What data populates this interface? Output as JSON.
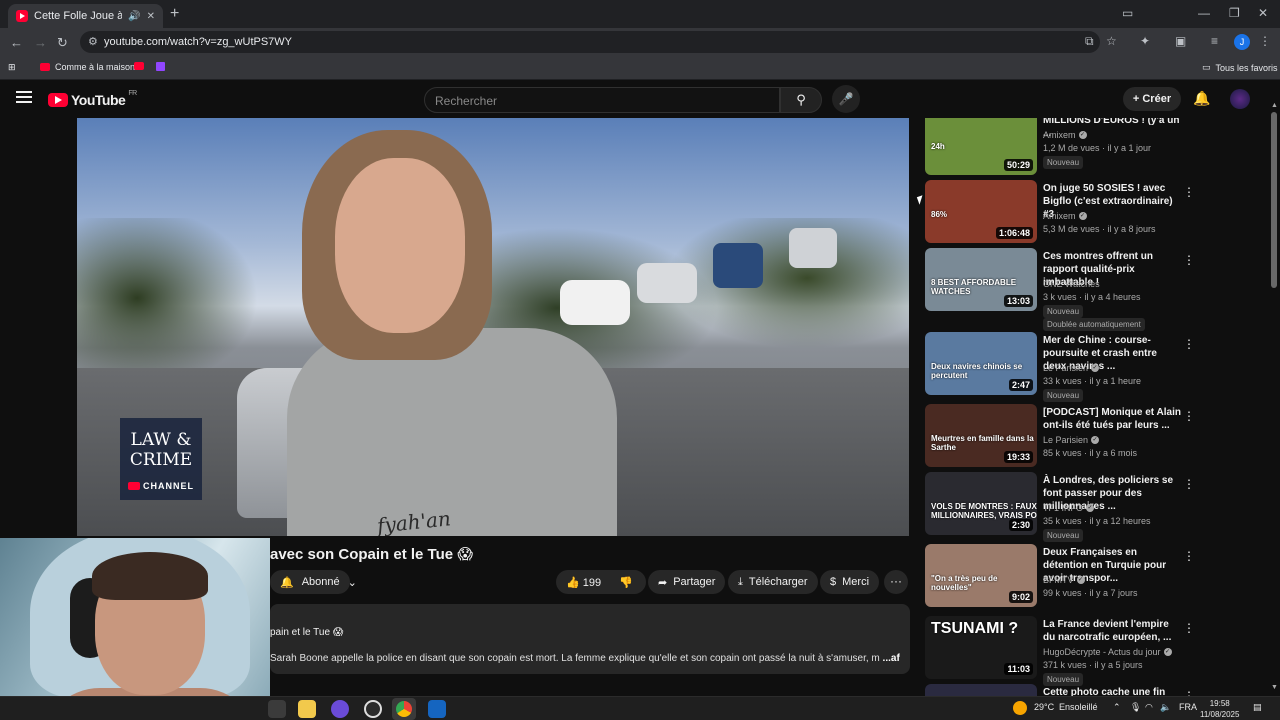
{
  "browser": {
    "tab_title": "Cette Folle Joue à Cache C",
    "url": "youtube.com/watch?v=zg_wUtPS7WY",
    "bookmarks": [
      {
        "label": "Comme à la maison",
        "icon": "youtube-icon"
      },
      {
        "label": "",
        "icon": "youtube-icon"
      },
      {
        "label": "",
        "icon": "twitch-icon"
      }
    ],
    "all_bookmarks": "Tous les favoris",
    "profile_initial": "J"
  },
  "youtube": {
    "logo_text": "YouTube",
    "logo_region": "FR",
    "search_placeholder": "Rechercher",
    "create_label": "Créer"
  },
  "video": {
    "overlay_brand": [
      "LAW",
      "&",
      "CRIME"
    ],
    "overlay_channel": "CHANNEL",
    "shirt_text": "fyah'an",
    "title": "avec son Copain et le Tue 😱",
    "subscribe_label": "Abonné",
    "likes": "199",
    "share_label": "Partager",
    "download_label": "Télécharger",
    "thanks_label": "Merci",
    "description_line1": "pain et le Tue 😱",
    "description_line2": "Sarah Boone appelle la police en disant que son copain est mort. La femme explique qu'elle et son copain ont passé la nuit à s'amuser, m",
    "description_more": "...afficher plus"
  },
  "sidebar": {
    "items": [
      {
        "title": "MILLIONS D'EUROS ! (y'a un ...",
        "channel": "Amixem",
        "verified": true,
        "views": "1,2 M de vues · il y a 1 jour",
        "badge": "Nouveau",
        "extra_badge": "",
        "duration": "50:29",
        "thumb_text": "24h",
        "thumb_color": "#6b8f3a"
      },
      {
        "title": "On juge 50 SOSIES ! avec Bigflo (c'est extraordinaire) #3",
        "channel": "Amixem",
        "verified": true,
        "views": "5,3 M de vues · il y a 8 jours",
        "badge": "",
        "extra_badge": "",
        "duration": "1:06:48",
        "thumb_text": "86%",
        "thumb_color": "#8a3a2a"
      },
      {
        "title": "Ces montres offrent un rapport qualité-prix imbattable !",
        "channel": "ONE Watches",
        "verified": false,
        "views": "3 k vues · il y a 4 heures",
        "badge": "Nouveau",
        "extra_badge": "Doublée automatiquement",
        "duration": "13:03",
        "thumb_text": "8 BEST AFFORDABLE WATCHES",
        "thumb_color": "#7a8a96"
      },
      {
        "title": "Mer de Chine : course-poursuite et crash entre deux navires ...",
        "channel": "Le Parisien",
        "verified": true,
        "views": "33 k vues · il y a 1 heure",
        "badge": "Nouveau",
        "extra_badge": "",
        "duration": "2:47",
        "thumb_text": "Deux navires chinois se percutent",
        "thumb_color": "#5a7aa0"
      },
      {
        "title": "[PODCAST] Monique et Alain ont-ils été tués par leurs ...",
        "channel": "Le Parisien",
        "verified": true,
        "views": "85 k vues · il y a 6 mois",
        "badge": "",
        "extra_badge": "",
        "duration": "19:33",
        "thumb_text": "Meurtres en famille dans la Sarthe",
        "thumb_color": "#4a2a22"
      },
      {
        "title": "À Londres, des policiers se font passer pour des millionnaires ...",
        "channel": "TF1 INFO",
        "verified": true,
        "views": "35 k vues · il y a 12 heures",
        "badge": "Nouveau",
        "extra_badge": "",
        "duration": "2:30",
        "thumb_text": "VOLS DE MONTRES : FAUX MILLIONNAIRES, VRAIS PO",
        "thumb_color": "#2a2a30"
      },
      {
        "title": "Deux Françaises en détention en Turquie pour avoir transpor...",
        "channel": "BFMTV",
        "verified": true,
        "views": "99 k vues · il y a 7 jours",
        "badge": "",
        "extra_badge": "",
        "duration": "9:02",
        "thumb_text": "\"On a très peu de nouvelles\"",
        "thumb_color": "#9a7a6a"
      },
      {
        "title": "La France devient l'empire du narcotrafic européen, ...",
        "channel": "HugoDécrypte - Actus du jour",
        "verified": true,
        "views": "371 k vues · il y a 5 jours",
        "badge": "Nouveau",
        "extra_badge": "",
        "duration": "11:03",
        "thumb_text": "TSUNAMI ?",
        "thumb_color": "#1a1a1a"
      },
      {
        "title": "Cette photo cache une fin",
        "channel": "",
        "verified": false,
        "views": "",
        "badge": "",
        "extra_badge": "",
        "duration": "",
        "thumb_text": "",
        "thumb_color": "#2a2a40"
      }
    ]
  },
  "taskbar": {
    "temperature": "29°C",
    "weather": "Ensoleillé",
    "language": "FRA",
    "time": "19:58",
    "date": "11/08/2025"
  }
}
